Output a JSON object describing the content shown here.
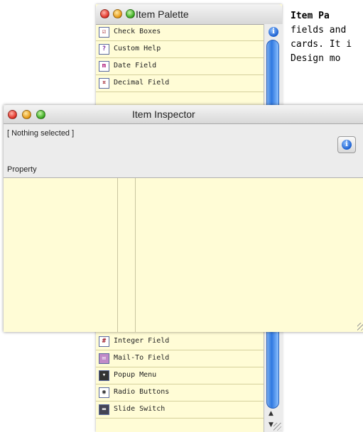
{
  "palette": {
    "title": "Item Palette",
    "items": [
      {
        "label": "Check Boxes",
        "icon": "checkbox-icon",
        "glyph": "☑"
      },
      {
        "label": "Custom Help",
        "icon": "help-icon",
        "glyph": "?"
      },
      {
        "label": "Date Field",
        "icon": "date-icon",
        "glyph": "m"
      },
      {
        "label": "Decimal Field",
        "icon": "decimal-icon",
        "glyph": "¤"
      }
    ],
    "items_bottom": [
      {
        "label": "Integer Field",
        "icon": "integer-icon",
        "glyph": "#"
      },
      {
        "label": "Mail-To Field",
        "icon": "mail-icon",
        "glyph": "✉"
      },
      {
        "label": "Popup Menu",
        "icon": "popup-icon",
        "glyph": "▾"
      },
      {
        "label": "Radio Buttons",
        "icon": "radio-icon",
        "glyph": "◉"
      },
      {
        "label": "Slide Switch",
        "icon": "switch-icon",
        "glyph": "▬"
      }
    ]
  },
  "side_text": {
    "heading": "Item Pa",
    "lines": [
      "fields and",
      "cards. It i",
      "Design mo"
    ]
  },
  "inspector": {
    "title": "Item Inspector",
    "selection": "[ Nothing selected ]",
    "property_label": "Property"
  },
  "colors": {
    "list_background": "#fffcd6",
    "accent": "#2f78e0"
  }
}
